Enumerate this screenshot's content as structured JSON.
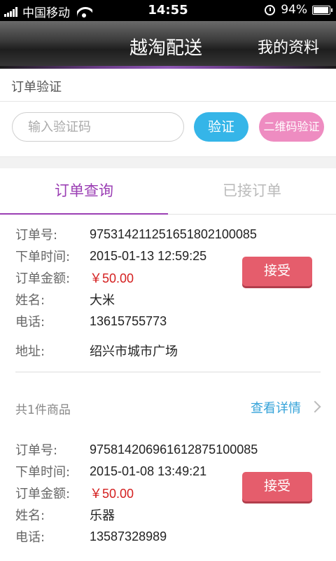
{
  "status_bar": {
    "carrier": "中国移动",
    "time": "14:55",
    "battery": "94%",
    "battery_level": 0.94
  },
  "header": {
    "title": "越淘配送",
    "profile_label": "我的资料"
  },
  "verify": {
    "title": "订单验证",
    "input_placeholder": "输入验证码",
    "verify_button": "验证",
    "qr_button": "二维码验证"
  },
  "tabs": [
    {
      "label": "订单查询",
      "active": true
    },
    {
      "label": "已接订单",
      "active": false
    }
  ],
  "orders": [
    {
      "order_no_label": "订单号:",
      "order_no": "97531421125165180210008​5",
      "time_label": "下单时间:",
      "time": "2015-01-13 12:59:25",
      "amount_label": "订单金额:",
      "amount": "￥50.00",
      "name_label": "姓名:",
      "name": "大米",
      "phone_label": "电话:",
      "phone": "13615755773",
      "address_label": "地址:",
      "address": "绍兴市城市广场",
      "accept_button": "接受",
      "summary": "共1件商品",
      "detail_link": "查看详情"
    },
    {
      "order_no_label": "订单号:",
      "order_no": "97581420696161287510008​5",
      "time_label": "下单时间:",
      "time": "2015-01-08 13:49:21",
      "amount_label": "订单金额:",
      "amount": "￥50.00",
      "name_label": "姓名:",
      "name": "乐器",
      "phone_label": "电话:",
      "phone": "13587328989",
      "accept_button": "接受"
    }
  ]
}
